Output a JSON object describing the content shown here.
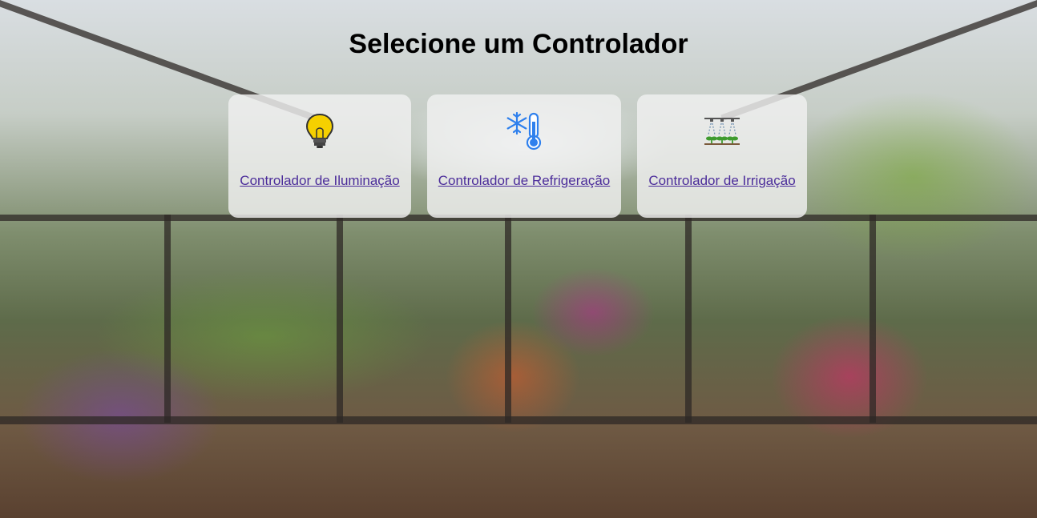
{
  "header": {
    "title": "Selecione um Controlador"
  },
  "controllers": [
    {
      "label": "Controlador de Iluminação",
      "icon": "lightbulb-icon"
    },
    {
      "label": "Controlador de Refrigeração",
      "icon": "snowflake-thermometer-icon"
    },
    {
      "label": "Controlador de Irrigação",
      "icon": "sprinkler-plants-icon"
    }
  ],
  "colors": {
    "link": "#4b2c9a",
    "card_bg": "#f0f0f0",
    "bulb": "#f5d000",
    "cool": "#2f80ed"
  }
}
